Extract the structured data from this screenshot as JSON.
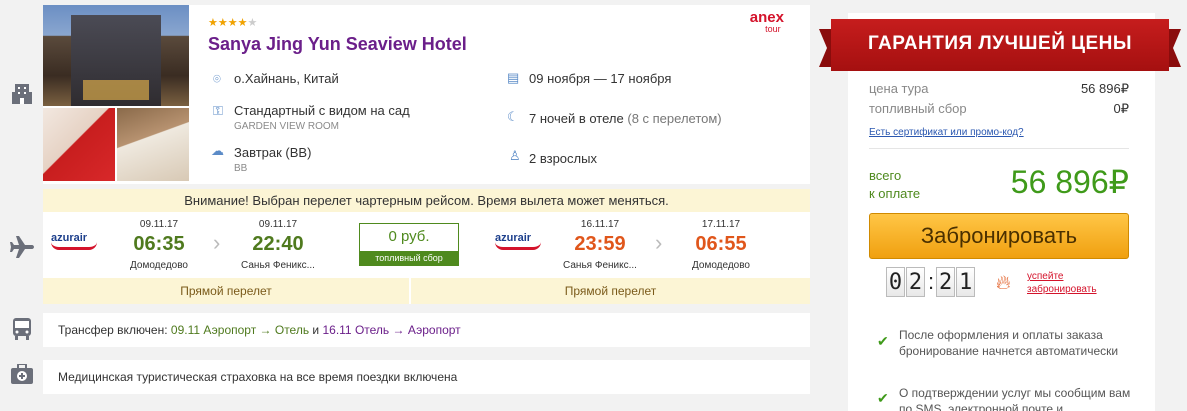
{
  "hotel": {
    "stars_on": "★★★★",
    "stars_off": "★",
    "name": "Sanya Jing Yun Seaview Hotel",
    "operator_line1": "anex",
    "operator_line2": "tour",
    "location": "о.Хайнань, Китай",
    "room": "Стандартный с видом на сад",
    "room_sub": "GARDEN VIEW ROOM",
    "meal": "Завтрак (BB)",
    "meal_sub": "BB",
    "dates": "09 ноября — 17 ноября",
    "nights": "7 ночей в отеле",
    "nights_extra": "(8 с перелетом)",
    "guests": "2 взрослых"
  },
  "warning": "Внимание! Выбран перелет чартерным рейсом. Время вылета может меняться.",
  "flight": {
    "airline_logo": "azurair",
    "out": {
      "dep_date": "09.11.17",
      "dep_time": "06:35",
      "dep_airport": "Домодедово",
      "arr_date": "09.11.17",
      "arr_time": "22:40",
      "arr_airport": "Санья Феникс..."
    },
    "fuel_value": "0 руб.",
    "fuel_label": "топливный сбор",
    "back": {
      "dep_date": "16.11.17",
      "dep_time": "23:59",
      "dep_airport": "Санья Феникс...",
      "arr_date": "17.11.17",
      "arr_time": "06:55",
      "arr_airport": "Домодедово"
    },
    "direct_out": "Прямой перелет",
    "direct_back": "Прямой перелет"
  },
  "transfer": {
    "prefix": "Трансфер включен: ",
    "leg1": "09.11 Аэропорт → Отель",
    "and": " и ",
    "leg2": "16.11 Отель → Аэропорт"
  },
  "insurance": "Медицинская туристическая страховка на все время поездки включена",
  "price": {
    "ribbon": "ГАРАНТИЯ ЛУЧШЕЙ ЦЕНЫ",
    "tour_label": "цена тура",
    "tour_value": "56 896₽",
    "fuel_label": "топливный сбор",
    "fuel_value": "0₽",
    "promo": "Есть сертификат или промо-код?",
    "total_label1": "всего",
    "total_label2": "к оплате",
    "total_value": "56 896₽",
    "book": "Забронировать",
    "timer": [
      "0",
      "2",
      "2",
      "1"
    ],
    "hurry1": "успейте",
    "hurry2": "забронировать",
    "note1": "После оформления и оплаты заказа бронирование начнется автоматически",
    "note2": "О подтверждении услуг мы сообщим вам по SMS, электронной почте и"
  },
  "colors": {
    "accent_purple": "#6b1f8a",
    "green": "#3f9a1a",
    "orange": "#e0561b",
    "ribbon_red": "#c61d1d",
    "button": "#f0a010"
  }
}
